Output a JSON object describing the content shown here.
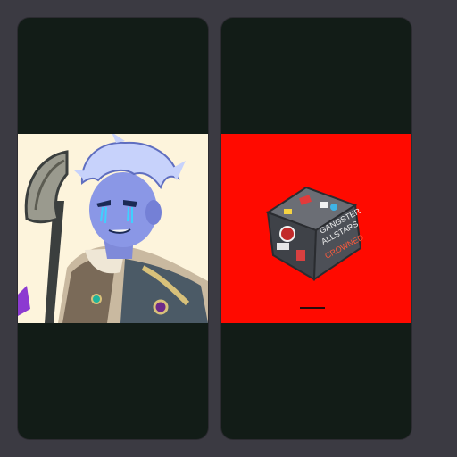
{
  "gallery": {
    "cards": [
      {
        "image_subject": "character-portrait",
        "colors": {
          "card_bg": "#121c17",
          "image_bg": "#fdf4dc",
          "skin": "#8a97e6",
          "hair": "#c7d2fb"
        },
        "caption": ""
      },
      {
        "image_subject": "sticker-cube",
        "colors": {
          "card_bg": "#121c17",
          "image_bg": "#ff0a00",
          "cube": "#4a4d54"
        },
        "caption": ""
      }
    ]
  },
  "colors": {
    "page_bg": "#3b3a42"
  }
}
